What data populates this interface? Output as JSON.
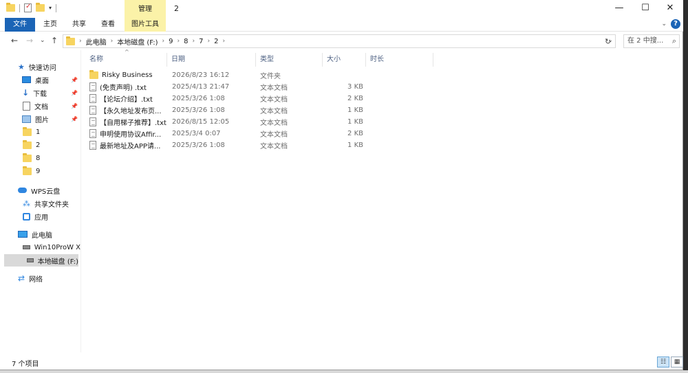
{
  "window": {
    "title": "2",
    "context_tab_group": "管理",
    "controls": {
      "minimize": "—",
      "maximize": "☐",
      "close": "✕"
    }
  },
  "ribbon": {
    "tabs": [
      {
        "label": "文件",
        "active": true
      },
      {
        "label": "主页"
      },
      {
        "label": "共享"
      },
      {
        "label": "查看"
      },
      {
        "label": "图片工具"
      }
    ],
    "help": "?"
  },
  "nav": {
    "back": "←",
    "forward": "→",
    "recent": "⌄",
    "up": "↑",
    "breadcrumb": [
      "此电脑",
      "本地磁盘 (F:)",
      "9",
      "8",
      "7",
      "2"
    ],
    "refresh": "↻",
    "search_placeholder": "在 2 中搜..."
  },
  "sidebar": {
    "quick_access": "快速访问",
    "pinned": [
      {
        "label": "桌面",
        "icon": "desktop-icon"
      },
      {
        "label": "下载",
        "icon": "download-icon"
      },
      {
        "label": "文档",
        "icon": "document-icon"
      },
      {
        "label": "图片",
        "icon": "pictures-icon"
      }
    ],
    "recent_folders": [
      "1",
      "2",
      "8",
      "9"
    ],
    "wps_cloud": "WPS云盘",
    "wps_items": [
      {
        "label": "共享文件夹",
        "icon": "share-icon"
      },
      {
        "label": "应用",
        "icon": "app-icon"
      }
    ],
    "this_pc": "此电脑",
    "drives": [
      {
        "label": "Win10ProW X",
        "selected": false
      },
      {
        "label": "本地磁盘 (F:)",
        "selected": true
      }
    ],
    "network": "网络"
  },
  "columns": {
    "name": "名称",
    "date": "日期",
    "type": "类型",
    "size": "大小",
    "duration": "时长"
  },
  "files": [
    {
      "name": "Risky Business",
      "date": "2026/8/23 16:12",
      "type": "文件夹",
      "size": "",
      "kind": "folder"
    },
    {
      "name": "(免责声明) .txt",
      "date": "2025/4/13 21:47",
      "type": "文本文档",
      "size": "3 KB",
      "kind": "txt"
    },
    {
      "name": "【论坛介绍】.txt",
      "date": "2025/3/26 1:08",
      "type": "文本文档",
      "size": "2 KB",
      "kind": "txt"
    },
    {
      "name": "【永久地址发布页...",
      "date": "2025/3/26 1:08",
      "type": "文本文档",
      "size": "1 KB",
      "kind": "txt"
    },
    {
      "name": "【自用梯子推荐】.txt",
      "date": "2026/8/15 12:05",
      "type": "文本文档",
      "size": "1 KB",
      "kind": "txt"
    },
    {
      "name": "申明使用协议Affir...",
      "date": "2025/3/4 0:07",
      "type": "文本文档",
      "size": "2 KB",
      "kind": "txt"
    },
    {
      "name": "最新地址及APP请...",
      "date": "2025/3/26 1:08",
      "type": "文本文档",
      "size": "1 KB",
      "kind": "txt"
    }
  ],
  "status": {
    "item_count": "7 个项目"
  }
}
